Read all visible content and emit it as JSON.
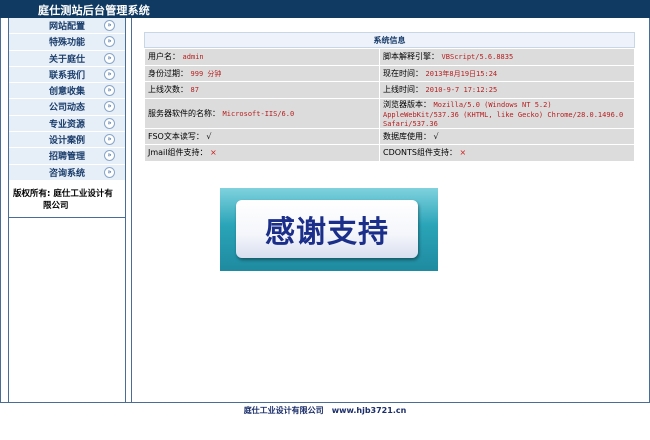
{
  "header": {
    "title": "庭仕测站后台管理系统"
  },
  "sidebar": {
    "items": [
      {
        "label": "网站配置"
      },
      {
        "label": "特殊功能"
      },
      {
        "label": "关于庭仕"
      },
      {
        "label": "联系我们"
      },
      {
        "label": "创意收集"
      },
      {
        "label": "公司动态"
      },
      {
        "label": "专业资源"
      },
      {
        "label": "设计案例"
      },
      {
        "label": "招聘管理"
      },
      {
        "label": "咨询系统"
      }
    ],
    "copyright_line1": "版权所有: 庭仕工业设计有",
    "copyright_line2": "限公司"
  },
  "system_info": {
    "title": "系统信息",
    "rows": [
      {
        "l_label": "用户名：",
        "l_value": "admin",
        "r_label": "脚本解释引擎：",
        "r_value": "VBScript/5.6.8835"
      },
      {
        "l_label": "身份过期：",
        "l_value": "999 分钟",
        "r_label": "现在时间：",
        "r_value": "2013年8月19日15:24"
      },
      {
        "l_label": "上线次数：",
        "l_value": "87",
        "r_label": "上线时间：",
        "r_value": "2010-9-7 17:12:25"
      },
      {
        "l_label": "服务器软件的名称：",
        "l_value": "Microsoft-IIS/6.0",
        "r_label": "浏览器版本：",
        "r_value": "Mozilla/5.0 (Windows NT 5.2) AppleWebKit/537.36 (KHTML, like Gecko) Chrome/28.0.1496.0 Safari/537.36"
      },
      {
        "l_label": "FSO文本读写：",
        "l_value": "√",
        "r_label": "数据库使用：",
        "r_value": "√"
      },
      {
        "l_label": "Jmail组件支持：",
        "l_value": "×",
        "r_label": "CDONTS组件支持：",
        "r_value": "×"
      }
    ]
  },
  "banner": {
    "text": "感谢支持"
  },
  "footer": {
    "company": "庭仕工业设计有限公司",
    "url": "www.hjb3721.cn"
  }
}
